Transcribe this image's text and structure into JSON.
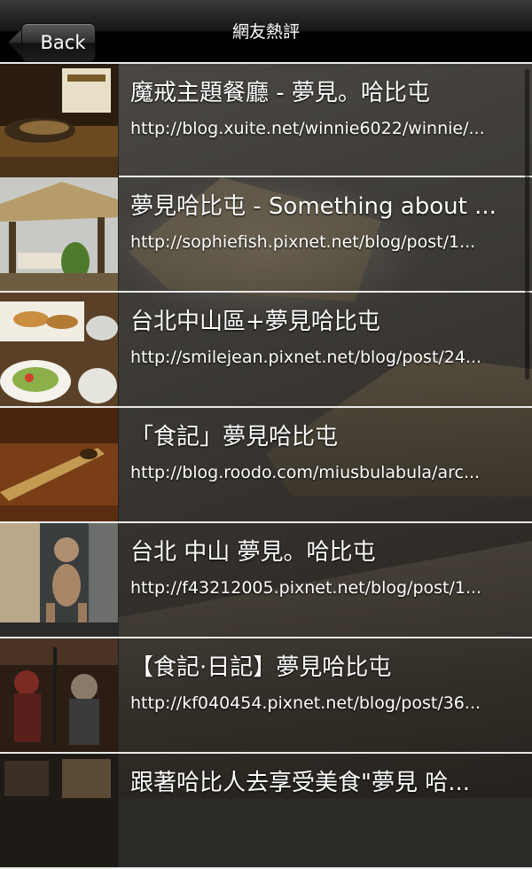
{
  "nav": {
    "back_label": "Back",
    "title": "網友熱評"
  },
  "list": [
    {
      "title": "魔戒主題餐廳 - 夢見。哈比屯",
      "url": "http://blog.xuite.net/winnie6022/winnie/...",
      "thumb": "restaurant-table-thumbnail"
    },
    {
      "title": "夢見哈比屯 - Something about ...",
      "url": "http://sophiefish.pixnet.net/blog/post/1...",
      "thumb": "thatched-pavilion-thumbnail"
    },
    {
      "title": "台北中山區+夢見哈比屯",
      "url": "http://smilejean.pixnet.net/blog/post/24...",
      "thumb": "food-plates-thumbnail"
    },
    {
      "title": "「食記」夢見哈比屯",
      "url": "http://blog.roodo.com/miusbulabula/arc...",
      "thumb": "sword-hilt-thumbnail"
    },
    {
      "title": "台北 中山 夢見。哈比屯",
      "url": "http://f43212005.pixnet.net/blog/post/1...",
      "thumb": "gollum-statue-thumbnail"
    },
    {
      "title": "【食記·日記】夢見哈比屯",
      "url": "http://kf040454.pixnet.net/blog/post/36...",
      "thumb": "armor-figures-thumbnail"
    },
    {
      "title": "跟著哈比人去享受美食\"夢見 哈...",
      "url": "",
      "thumb": "interior-thumbnail"
    }
  ],
  "colors": {
    "navbar": "#000000",
    "row_text": "#ffffff",
    "divider": "#e9e9e9"
  }
}
